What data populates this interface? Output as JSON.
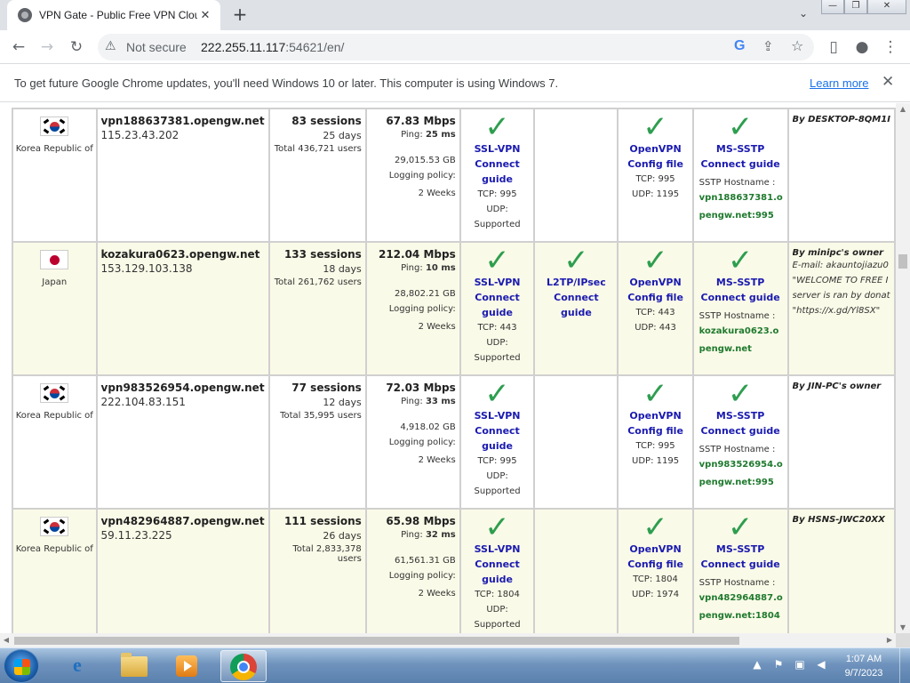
{
  "browser": {
    "tab_title": "VPN Gate - Public Free VPN Cloud",
    "tab_close": "✕",
    "new_tab": "+",
    "tab_search": "⌄",
    "window_controls": {
      "minimize": "—",
      "maximize": "❐",
      "close": "✕"
    },
    "nav": {
      "back": "←",
      "forward": "→",
      "reload": "↻"
    },
    "security_label": "Not secure",
    "url_host": "222.255.11.117",
    "url_rest": ":54621/en/",
    "toolbar_icons": {
      "google": "G",
      "share": "⇪",
      "bookmark": "☆",
      "sidepanel": "▯",
      "profile": "●",
      "menu": "⋮"
    }
  },
  "infobar": {
    "message": "To get future Google Chrome updates, you'll need Windows 10 or later. This computer is using Windows 7.",
    "learn_more": "Learn more",
    "close": "✕"
  },
  "servers": [
    {
      "flag": "kr",
      "country": "Korea Republic of",
      "hostname": "vpn188637381.opengw.net",
      "ip": "115.23.43.202",
      "sessions": "83 sessions",
      "days": "25 days",
      "total_users": "Total 436,721 users",
      "speed": "67.83 Mbps",
      "ping_label": "Ping:",
      "ping": "25 ms",
      "traffic": "29,015.53 GB",
      "logging_label": "Logging policy:",
      "logging": "2 Weeks",
      "ssl": {
        "check": "✓",
        "name": "SSL-VPN",
        "guide": "Connect guide",
        "tcp": "TCP: 995",
        "udp": "UDP: Supported"
      },
      "l2tp": null,
      "openvpn": {
        "check": "✓",
        "name": "OpenVPN",
        "config": "Config file",
        "tcp": "TCP: 995",
        "udp": "UDP: 1195"
      },
      "sstp": {
        "check": "✓",
        "name": "MS-SSTP",
        "guide": "Connect guide",
        "host_label": "SSTP Hostname :",
        "host": "vpn188637381.opengw.net:995"
      },
      "operator": "By DESKTOP-8QM1I",
      "operator_msg": []
    },
    {
      "flag": "jp",
      "country": "Japan",
      "hostname": "kozakura0623.opengw.net",
      "ip": "153.129.103.138",
      "sessions": "133 sessions",
      "days": "18 days",
      "total_users": "Total 261,762 users",
      "speed": "212.04 Mbps",
      "ping_label": "Ping:",
      "ping": "10 ms",
      "traffic": "28,802.21 GB",
      "logging_label": "Logging policy:",
      "logging": "2 Weeks",
      "ssl": {
        "check": "✓",
        "name": "SSL-VPN",
        "guide": "Connect guide",
        "tcp": "TCP: 443",
        "udp": "UDP: Supported"
      },
      "l2tp": {
        "check": "✓",
        "name": "L2TP/IPsec",
        "guide": "Connect guide"
      },
      "openvpn": {
        "check": "✓",
        "name": "OpenVPN",
        "config": "Config file",
        "tcp": "TCP: 443",
        "udp": "UDP: 443"
      },
      "sstp": {
        "check": "✓",
        "name": "MS-SSTP",
        "guide": "Connect guide",
        "host_label": "SSTP Hostname :",
        "host": "kozakura0623.opengw.net"
      },
      "operator": "By minipc's owner",
      "operator_msg": [
        "E-mail: akauntojiazu0",
        "\"WELCOME TO FREE I",
        "server is ran by donat",
        "\"https://x.gd/Yl8SX\""
      ]
    },
    {
      "flag": "kr",
      "country": "Korea Republic of",
      "hostname": "vpn983526954.opengw.net",
      "ip": "222.104.83.151",
      "sessions": "77 sessions",
      "days": "12 days",
      "total_users": "Total 35,995 users",
      "speed": "72.03 Mbps",
      "ping_label": "Ping:",
      "ping": "33 ms",
      "traffic": "4,918.02 GB",
      "logging_label": "Logging policy:",
      "logging": "2 Weeks",
      "ssl": {
        "check": "✓",
        "name": "SSL-VPN",
        "guide": "Connect guide",
        "tcp": "TCP: 995",
        "udp": "UDP: Supported"
      },
      "l2tp": null,
      "openvpn": {
        "check": "✓",
        "name": "OpenVPN",
        "config": "Config file",
        "tcp": "TCP: 995",
        "udp": "UDP: 1195"
      },
      "sstp": {
        "check": "✓",
        "name": "MS-SSTP",
        "guide": "Connect guide",
        "host_label": "SSTP Hostname :",
        "host": "vpn983526954.opengw.net:995"
      },
      "operator": "By JIN-PC's owner",
      "operator_msg": []
    },
    {
      "flag": "kr",
      "country": "Korea Republic of",
      "hostname": "vpn482964887.opengw.net",
      "ip": "59.11.23.225",
      "sessions": "111 sessions",
      "days": "26 days",
      "total_users": "Total 2,833,378 users",
      "speed": "65.98 Mbps",
      "ping_label": "Ping:",
      "ping": "32 ms",
      "traffic": "61,561.31 GB",
      "logging_label": "Logging policy:",
      "logging": "2 Weeks",
      "ssl": {
        "check": "✓",
        "name": "SSL-VPN",
        "guide": "Connect guide",
        "tcp": "TCP: 1804",
        "udp": "UDP: Supported"
      },
      "l2tp": null,
      "openvpn": {
        "check": "✓",
        "name": "OpenVPN",
        "config": "Config file",
        "tcp": "TCP: 1804",
        "udp": "UDP: 1974"
      },
      "sstp": {
        "check": "✓",
        "name": "MS-SSTP",
        "guide": "Connect guide",
        "host_label": "SSTP Hostname :",
        "host": "vpn482964887.opengw.net:1804"
      },
      "operator": "By HSNS-JWC20XX",
      "operator_msg": []
    }
  ],
  "taskbar": {
    "clock_time": "1:07 AM",
    "clock_date": "9/7/2023",
    "tray_icons": {
      "show_hidden": "▲",
      "flag": "⚑",
      "network": "▣",
      "volume": "◀"
    }
  },
  "colors": {
    "check_green": "#2e9e4f",
    "protocol_link": "#1a1ab0",
    "sstp_host": "#1f7a2e",
    "row_alt": "#fafae8",
    "chrome_link": "#1a73e8"
  }
}
